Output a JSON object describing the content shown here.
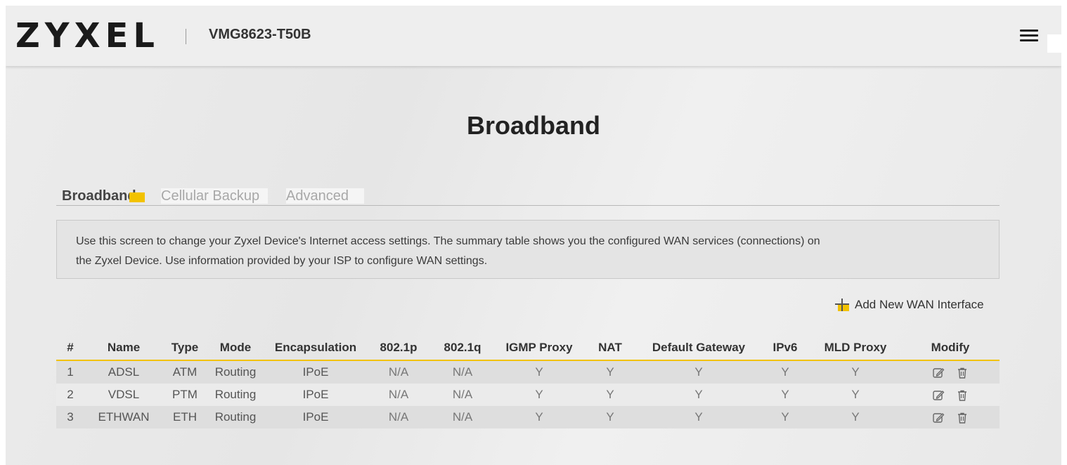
{
  "header": {
    "brand": "ZYXEL",
    "model": "VMG8623-T50B",
    "menu_icon": "hamburger-menu-icon"
  },
  "page": {
    "title": "Broadband"
  },
  "tabs": [
    {
      "label": "Broadband",
      "active": true
    },
    {
      "label": "Cellular Backup",
      "active": false
    },
    {
      "label": "Advanced",
      "active": false
    }
  ],
  "info": {
    "line1": "Use this screen to change your Zyxel Device's Internet access settings. The summary table shows you the configured WAN services (connections) on",
    "line2": "the Zyxel Device. Use information provided by your ISP to configure WAN settings."
  },
  "actions": {
    "add_label": "Add New WAN Interface",
    "add_icon": "plus-icon"
  },
  "table": {
    "headers": [
      "#",
      "Name",
      "Type",
      "Mode",
      "Encapsulation",
      "802.1p",
      "802.1q",
      "IGMP Proxy",
      "NAT",
      "Default Gateway",
      "IPv6",
      "MLD Proxy",
      "Modify"
    ],
    "rows": [
      [
        "1",
        "ADSL",
        "ATM",
        "Routing",
        "IPoE",
        "N/A",
        "N/A",
        "Y",
        "Y",
        "Y",
        "Y",
        "Y"
      ],
      [
        "2",
        "VDSL",
        "PTM",
        "Routing",
        "IPoE",
        "N/A",
        "N/A",
        "Y",
        "Y",
        "Y",
        "Y",
        "Y"
      ],
      [
        "3",
        "ETHWAN",
        "ETH",
        "Routing",
        "IPoE",
        "N/A",
        "N/A",
        "Y",
        "Y",
        "Y",
        "Y",
        "Y"
      ]
    ],
    "modify_icons": [
      "edit-icon",
      "trash-icon"
    ]
  },
  "colors": {
    "accent": "#f2c200",
    "background": "#ebebeb",
    "header_bg": "#eeeeee"
  }
}
